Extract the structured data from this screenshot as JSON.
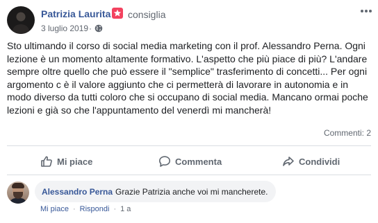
{
  "post": {
    "author": "Patrizia Laurita",
    "badge_icon": "star-icon",
    "action_text": "consiglia",
    "date": "3 luglio 2019",
    "date_separator": "·",
    "privacy_icon": "globe-icon",
    "text_lines": [
      "Sto ultimando il corso di social media marketing con il prof. Alessandro Perna. Ogni",
      "lezione è un momento altamente formativo. L'aspetto che più piace di più? L'andare",
      "sempre oltre quello che può essere il \"semplice\" trasferimento di concetti... Per ogni",
      "argomento c è il valore aggiunto che ci permetterà di lavorare in autonomia e in",
      "modo diverso da tutti coloro che si occupano di social media. Mancano ormai poche",
      "lezioni e già so che l'appuntamento del venerdì mi mancherà!"
    ],
    "comments_count": "Commenti: 2"
  },
  "actions": {
    "like": "Mi piace",
    "comment": "Commenta",
    "share": "Condividi"
  },
  "comment": {
    "author": "Alessandro Perna",
    "text": "Grazie Patrizia anche voi mi mancherete.",
    "like_link": "Mi piace",
    "reply_link": "Rispondi",
    "separator": "·",
    "time": "1 a"
  },
  "colors": {
    "link_blue": "#385898",
    "badge_red": "#f3425f",
    "secondary_text": "#606770",
    "bubble_bg": "#f2f3f5"
  }
}
